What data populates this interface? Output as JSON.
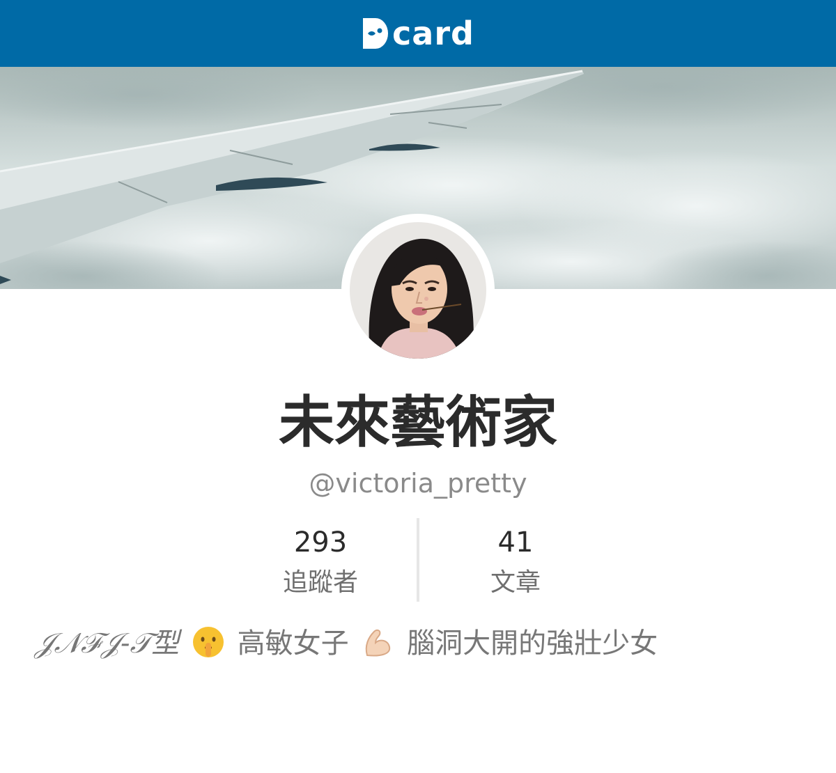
{
  "app": {
    "logo_text": "card",
    "brand_color": "#006aa6"
  },
  "profile": {
    "display_name": "未來藝術家",
    "username": "@victoria_pretty",
    "cover_image": "airplane-wing-over-clouds",
    "avatar_image": "woman-portrait-with-flower-stem"
  },
  "stats": {
    "followers_value": "293",
    "followers_label": "追蹤者",
    "posts_value": "41",
    "posts_label": "文章"
  },
  "bio": {
    "part1": "𝒥𝒩ℱ𝒥-𝒯型",
    "icon1": "shushing-face-emoji",
    "part2": "高敏女子",
    "icon2": "flexed-biceps-emoji",
    "part3": "腦洞大開的強壯少女"
  }
}
